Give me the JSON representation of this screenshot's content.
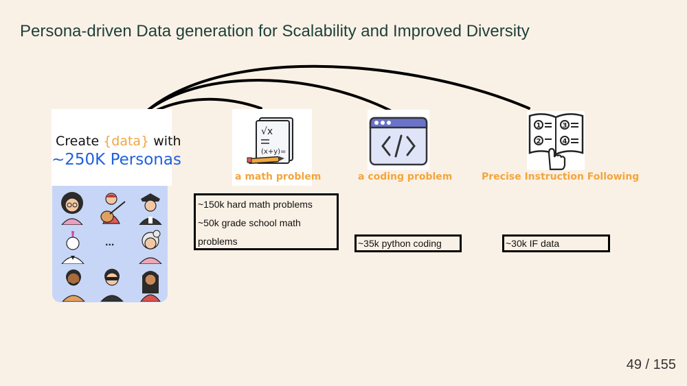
{
  "slide": {
    "title": "Persona-driven Data generation for Scalability and Improved Diversity",
    "page_number": "49 / 155"
  },
  "create_card": {
    "line1_prefix": "Create ",
    "line1_accent": "{data}",
    "line1_suffix": " with",
    "line2": "~250K Personas"
  },
  "colors": {
    "background": "#faf1e6",
    "title": "#1e3f3a",
    "accent_orange": "#f0a640",
    "persona_blue": "#1f5fe0",
    "persona_panel": "#c7d6f6"
  },
  "icons": [
    "math-worksheet-icon",
    "code-window-icon",
    "instruction-book-icon"
  ],
  "categories": [
    {
      "label": "a math problem",
      "lines": [
        "~150k hard math problems",
        "~50k grade school math",
        "problems"
      ]
    },
    {
      "label": "a coding problem",
      "lines": [
        "~35k python coding"
      ]
    },
    {
      "label": "Precise Instruction Following",
      "lines": [
        "~30k IF data"
      ]
    }
  ],
  "persona_grid": {
    "ellipsis": "..."
  }
}
